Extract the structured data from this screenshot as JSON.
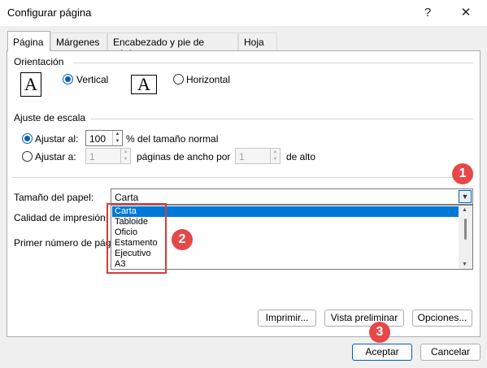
{
  "window": {
    "title": "Configurar página",
    "help": "?",
    "close": "✕"
  },
  "tabs": [
    {
      "label": "Página"
    },
    {
      "label": "Márgenes"
    },
    {
      "label": "Encabezado y pie de página"
    },
    {
      "label": "Hoja"
    }
  ],
  "orientation": {
    "heading": "Orientación",
    "vertical": "Vertical",
    "horizontal": "Horizontal",
    "icon_letter": "A",
    "selected": "vertical"
  },
  "scaling": {
    "heading": "Ajuste de escala",
    "adjust_to_label": "Ajustar al:",
    "adjust_to_value": "100",
    "adjust_to_suffix": "% del tamaño normal",
    "fit_to_label": "Ajustar a:",
    "pages_wide_value": "1",
    "pages_wide_suffix": "páginas de ancho por",
    "pages_tall_value": "1",
    "pages_tall_suffix": "de alto"
  },
  "paper_size": {
    "label": "Tamaño del papel:",
    "value": "Carta",
    "options": [
      "Carta",
      "Tabloide",
      "Oficio",
      "Estamento",
      "Ejecutivo",
      "A3"
    ]
  },
  "print_quality": {
    "label": "Calidad de impresión:"
  },
  "first_page": {
    "label": "Primer número de pági"
  },
  "buttons": {
    "print": "Imprimir...",
    "preview": "Vista preliminar",
    "options": "Opciones...",
    "ok": "Aceptar",
    "cancel": "Cancelar"
  },
  "callouts": [
    "1",
    "2",
    "3"
  ],
  "colors": {
    "accent": "#005fb8",
    "selection": "#0078d7",
    "callout": "#e64848"
  }
}
